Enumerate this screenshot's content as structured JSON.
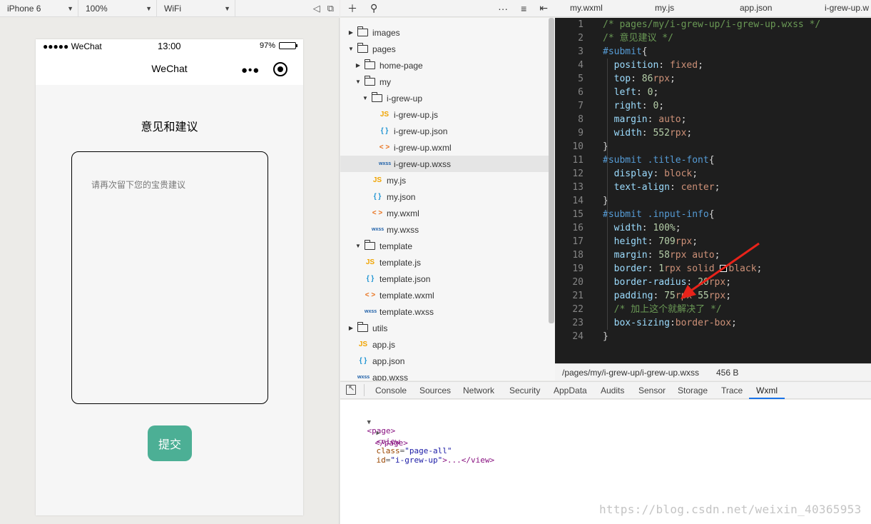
{
  "simulator": {
    "device": "iPhone 6",
    "zoom": "100%",
    "network": "WiFi",
    "status_bar": {
      "carrier": "●●●●● WeChat",
      "time": "13:00",
      "battery": "97%"
    },
    "nav_title": "WeChat",
    "page_heading": "意见和建议",
    "feedback_placeholder": "请再次留下您的宝贵建议",
    "submit_label": "提交"
  },
  "file_tree": [
    {
      "label": "images",
      "type": "folder",
      "expanded": false
    },
    {
      "label": "pages",
      "type": "folder",
      "expanded": true
    },
    {
      "label": "home-page",
      "type": "folder",
      "expanded": false
    },
    {
      "label": "my",
      "type": "folder",
      "expanded": true
    },
    {
      "label": "i-grew-up",
      "type": "folder",
      "expanded": true
    },
    {
      "label": "i-grew-up.js",
      "type": "js"
    },
    {
      "label": "i-grew-up.json",
      "type": "json"
    },
    {
      "label": "i-grew-up.wxml",
      "type": "wxml"
    },
    {
      "label": "i-grew-up.wxss",
      "type": "wxss",
      "selected": true
    },
    {
      "label": "my.js",
      "type": "js"
    },
    {
      "label": "my.json",
      "type": "json"
    },
    {
      "label": "my.wxml",
      "type": "wxml"
    },
    {
      "label": "my.wxss",
      "type": "wxss"
    },
    {
      "label": "template",
      "type": "folder",
      "expanded": true
    },
    {
      "label": "template.js",
      "type": "js"
    },
    {
      "label": "template.json",
      "type": "json"
    },
    {
      "label": "template.wxml",
      "type": "wxml"
    },
    {
      "label": "template.wxss",
      "type": "wxss"
    },
    {
      "label": "utils",
      "type": "folder",
      "expanded": false
    },
    {
      "label": "app.js",
      "type": "js"
    },
    {
      "label": "app.json",
      "type": "json"
    },
    {
      "label": "app.wxss",
      "type": "wxss"
    }
  ],
  "file_icons": {
    "js": "JS",
    "json": "{ }",
    "wxml": "< >",
    "wxss": "wxss"
  },
  "editor_tabs": [
    "my.wxml",
    "my.js",
    "app.json",
    "i-grew-up.w"
  ],
  "editor_status": {
    "path": "/pages/my/i-grew-up/i-grew-up.wxss",
    "size": "456 B"
  },
  "code_lines": [
    [
      [
        "c-com",
        "/* pages/my/i-grew-up/i-grew-up.wxss */"
      ]
    ],
    [
      [
        "c-com",
        "/* 意见建议 */"
      ]
    ],
    [
      [
        "c-sel",
        "#submit"
      ],
      [
        "c-punc",
        "{"
      ]
    ],
    [
      [
        "c-punc",
        "  "
      ],
      [
        "c-prop",
        "position"
      ],
      [
        "c-punc",
        ": "
      ],
      [
        "c-val",
        "fixed"
      ],
      [
        "c-punc",
        ";"
      ]
    ],
    [
      [
        "c-punc",
        "  "
      ],
      [
        "c-prop",
        "top"
      ],
      [
        "c-punc",
        ": "
      ],
      [
        "c-num",
        "86"
      ],
      [
        "c-unit",
        "rpx"
      ],
      [
        "c-punc",
        ";"
      ]
    ],
    [
      [
        "c-punc",
        "  "
      ],
      [
        "c-prop",
        "left"
      ],
      [
        "c-punc",
        ": "
      ],
      [
        "c-num",
        "0"
      ],
      [
        "c-punc",
        ";"
      ]
    ],
    [
      [
        "c-punc",
        "  "
      ],
      [
        "c-prop",
        "right"
      ],
      [
        "c-punc",
        ": "
      ],
      [
        "c-num",
        "0"
      ],
      [
        "c-punc",
        ";"
      ]
    ],
    [
      [
        "c-punc",
        "  "
      ],
      [
        "c-prop",
        "margin"
      ],
      [
        "c-punc",
        ": "
      ],
      [
        "c-val",
        "auto"
      ],
      [
        "c-punc",
        ";"
      ]
    ],
    [
      [
        "c-punc",
        "  "
      ],
      [
        "c-prop",
        "width"
      ],
      [
        "c-punc",
        ": "
      ],
      [
        "c-num",
        "552"
      ],
      [
        "c-unit",
        "rpx"
      ],
      [
        "c-punc",
        ";"
      ]
    ],
    [
      [
        "c-punc",
        "}"
      ]
    ],
    [
      [
        "c-sel",
        "#submit .title-font"
      ],
      [
        "c-punc",
        "{"
      ]
    ],
    [
      [
        "c-punc",
        "  "
      ],
      [
        "c-prop",
        "display"
      ],
      [
        "c-punc",
        ": "
      ],
      [
        "c-val",
        "block"
      ],
      [
        "c-punc",
        ";"
      ]
    ],
    [
      [
        "c-punc",
        "  "
      ],
      [
        "c-prop",
        "text-align"
      ],
      [
        "c-punc",
        ": "
      ],
      [
        "c-val",
        "center"
      ],
      [
        "c-punc",
        ";"
      ]
    ],
    [
      [
        "c-punc",
        "}"
      ]
    ],
    [
      [
        "c-sel",
        "#submit .input-info"
      ],
      [
        "c-punc",
        "{"
      ]
    ],
    [
      [
        "c-punc",
        "  "
      ],
      [
        "c-prop",
        "width"
      ],
      [
        "c-punc",
        ": "
      ],
      [
        "c-num",
        "100%"
      ],
      [
        "c-punc",
        ";"
      ]
    ],
    [
      [
        "c-punc",
        "  "
      ],
      [
        "c-prop",
        "height"
      ],
      [
        "c-punc",
        ": "
      ],
      [
        "c-num",
        "709"
      ],
      [
        "c-unit",
        "rpx"
      ],
      [
        "c-punc",
        ";"
      ]
    ],
    [
      [
        "c-punc",
        "  "
      ],
      [
        "c-prop",
        "margin"
      ],
      [
        "c-punc",
        ": "
      ],
      [
        "c-num",
        "58"
      ],
      [
        "c-unit",
        "rpx"
      ],
      [
        "c-val",
        " auto"
      ],
      [
        "c-punc",
        ";"
      ]
    ],
    [
      [
        "c-punc",
        "  "
      ],
      [
        "c-prop",
        "border"
      ],
      [
        "c-punc",
        ": "
      ],
      [
        "c-num",
        "1"
      ],
      [
        "c-unit",
        "rpx"
      ],
      [
        "c-val",
        " solid "
      ],
      [
        "swatch",
        ""
      ],
      [
        "c-val",
        "black"
      ],
      [
        "c-punc",
        ";"
      ]
    ],
    [
      [
        "c-punc",
        "  "
      ],
      [
        "c-prop",
        "border-radius"
      ],
      [
        "c-punc",
        ": "
      ],
      [
        "c-num",
        "20"
      ],
      [
        "c-unit",
        "rpx"
      ],
      [
        "c-punc",
        ";"
      ]
    ],
    [
      [
        "c-punc",
        "  "
      ],
      [
        "c-prop",
        "padding"
      ],
      [
        "c-punc",
        ": "
      ],
      [
        "c-num",
        "75"
      ],
      [
        "c-unit",
        "rpx"
      ],
      [
        "c-num",
        " 55"
      ],
      [
        "c-unit",
        "rpx"
      ],
      [
        "c-punc",
        ";"
      ]
    ],
    [
      [
        "c-punc",
        "  "
      ],
      [
        "c-com",
        "/* 加上这个就解决了 */"
      ]
    ],
    [
      [
        "c-punc",
        "  "
      ],
      [
        "c-prop",
        "box-sizing"
      ],
      [
        "c-punc",
        ":"
      ],
      [
        "c-val",
        "border-box"
      ],
      [
        "c-punc",
        ";"
      ]
    ],
    [
      [
        "c-punc",
        "}"
      ]
    ]
  ],
  "devtools_tabs": [
    "Console",
    "Sources",
    "Network",
    "Security",
    "AppData",
    "Audits",
    "Sensor",
    "Storage",
    "Trace",
    "Wxml"
  ],
  "devtools_active": "Wxml",
  "wxml": {
    "page_open": "<page>",
    "view_tag_open": "<view",
    "attr_class": "class",
    "val_class": "\"page-all\"",
    "attr_id": "id",
    "val_id": "\"i-grew-up\"",
    "view_rest": ">...</view>",
    "page_close": "</page>"
  },
  "watermark": "https://blog.csdn.net/weixin_40365953"
}
